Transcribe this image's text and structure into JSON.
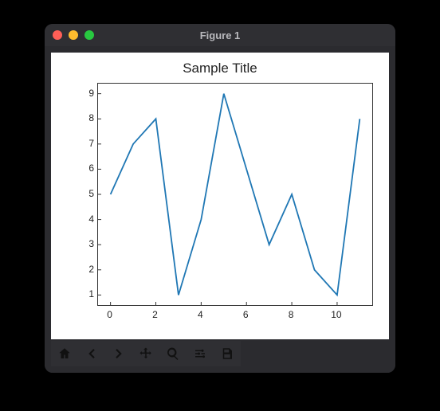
{
  "window": {
    "title": "Figure 1"
  },
  "chart_data": {
    "type": "line",
    "title": "Sample Title",
    "xlabel": "",
    "ylabel": "",
    "xlim": [
      -0.55,
      11.55
    ],
    "ylim": [
      0.6,
      9.4
    ],
    "xticks": [
      0,
      2,
      4,
      6,
      8,
      10
    ],
    "yticks": [
      1,
      2,
      3,
      4,
      5,
      6,
      7,
      8,
      9
    ],
    "x": [
      0,
      1,
      2,
      3,
      4,
      5,
      6,
      7,
      8,
      9,
      10,
      11
    ],
    "values": [
      5,
      7,
      8,
      1,
      4,
      9,
      6,
      3,
      5,
      2,
      1,
      8
    ],
    "line_color": "#1f77b4"
  },
  "toolbar": {
    "items": [
      {
        "name": "home-icon",
        "label": "Home"
      },
      {
        "name": "back-icon",
        "label": "Back"
      },
      {
        "name": "forward-icon",
        "label": "Forward"
      },
      {
        "name": "pan-icon",
        "label": "Pan"
      },
      {
        "name": "zoom-icon",
        "label": "Zoom"
      },
      {
        "name": "configure-icon",
        "label": "Configure subplots"
      },
      {
        "name": "save-icon",
        "label": "Save"
      }
    ]
  }
}
